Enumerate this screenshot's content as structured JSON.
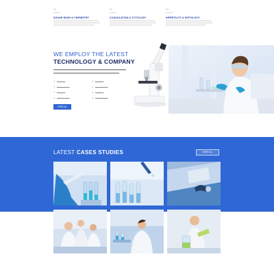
{
  "services": [
    {
      "num": "01",
      "title": "SUGAR BUSH & CHEMISTRY"
    },
    {
      "num": "02",
      "title": "COAGULATION & CYTOLOGY"
    },
    {
      "num": "03",
      "title": "INFERTILITY & HISTOLOGY"
    }
  ],
  "about": {
    "heading_light": "WE EMPLOY THE LATEST",
    "heading_bold": "TECHNOLOGY & COMPANY",
    "button_label": "VIEW ALL"
  },
  "cases": {
    "title_light": "LATEST",
    "title_bold": "CASES STUDIES",
    "button_label": "VIEW ALL"
  },
  "colors": {
    "brand_blue": "#2f67d6",
    "heading_navy": "#1d2b66",
    "accent_blue": "#2c62cc"
  }
}
